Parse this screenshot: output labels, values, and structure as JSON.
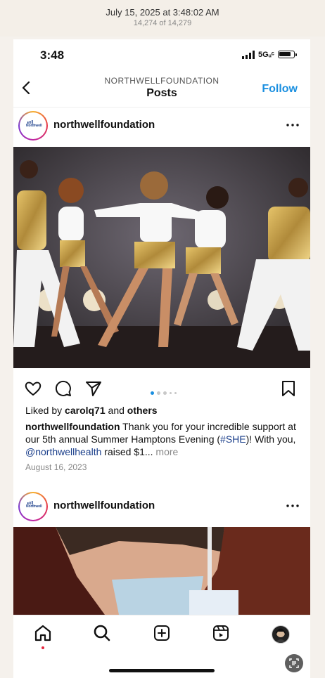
{
  "viewer": {
    "date": "July 15, 2025 at 3:48:02 AM",
    "count": "14,274 of 14,279"
  },
  "status": {
    "time": "3:48",
    "network": "5Gᵤᶜ"
  },
  "header": {
    "account": "NORTHWELLFOUNDATION",
    "title": "Posts",
    "follow_label": "Follow"
  },
  "post1": {
    "username": "northwellfoundation",
    "avatar_text": "Northwell",
    "likes_prefix": "Liked by ",
    "likes_user": "carolq71",
    "likes_and": " and ",
    "likes_others": "others",
    "caption_user": "northwellfoundation",
    "caption_part1": " Thank you for your incredible support at our 5th annual Summer Hamptons Evening (",
    "caption_tag": "#SHE",
    "caption_part2": ")! With you, ",
    "caption_mention": "@northwellhealth",
    "caption_part3": " raised $1...",
    "more_label": " more",
    "date": "August 16, 2023",
    "carousel_count": 5,
    "carousel_active": 0
  },
  "post2": {
    "username": "northwellfoundation",
    "avatar_text": "Northwell"
  },
  "icons": {
    "status": [
      "signal-icon",
      "battery-icon"
    ],
    "nav": [
      "back-chevron-icon"
    ],
    "actions": [
      "heart-icon",
      "comment-icon",
      "share-icon",
      "bookmark-icon"
    ],
    "tabs": [
      "home-icon",
      "search-icon",
      "create-icon",
      "reels-icon",
      "profile-avatar"
    ],
    "viewer": [
      "live-text-scan-icon"
    ]
  },
  "colors": {
    "accent": "#1a8fe0",
    "mention": "#1b3f8b",
    "notification": "#e5263e"
  }
}
